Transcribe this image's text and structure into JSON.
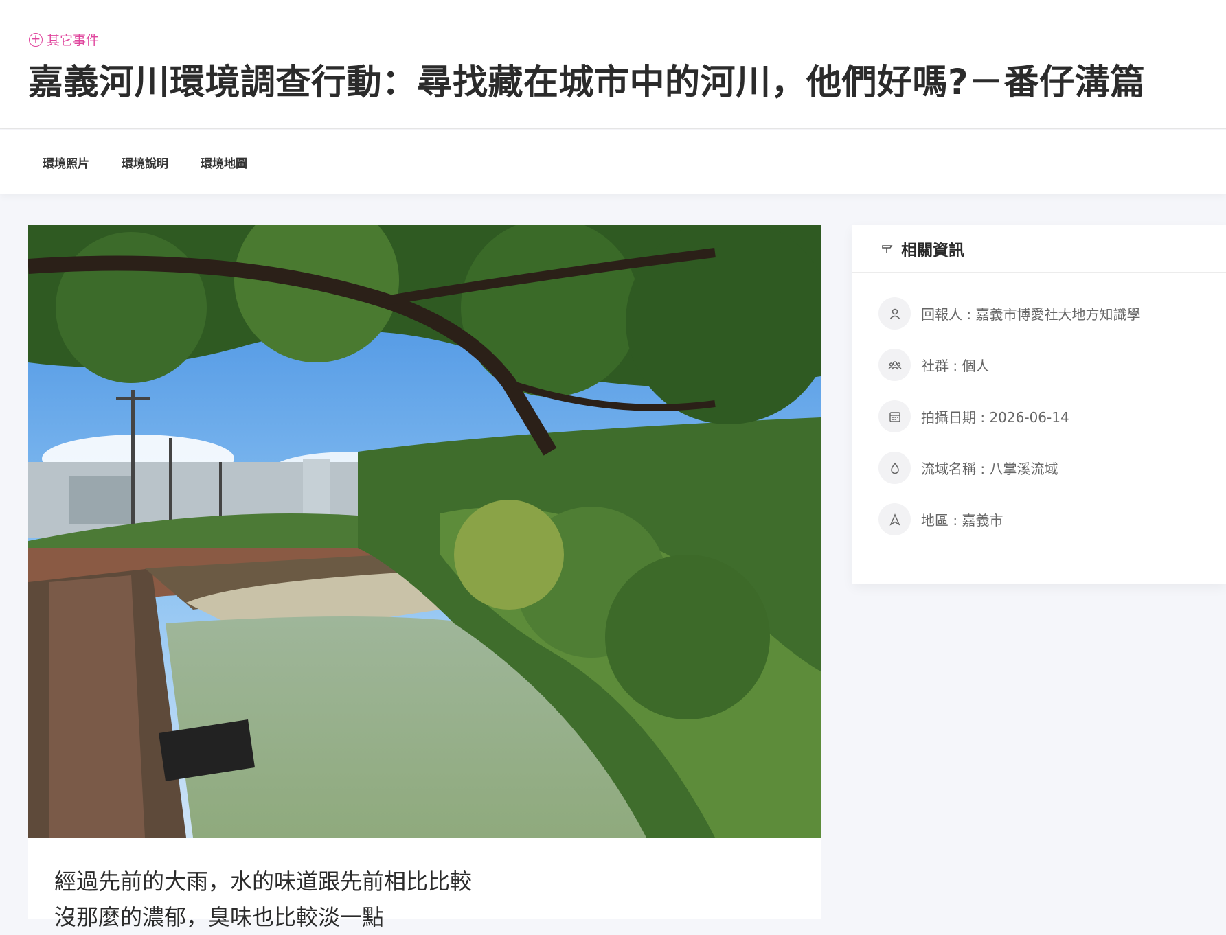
{
  "header": {
    "event_link_label": "其它事件",
    "title": "嘉義河川環境調查行動：尋找藏在城市中的河川，他們好嗎?－番仔溝篇"
  },
  "tabs": [
    {
      "label": "環境照片"
    },
    {
      "label": "環境說明"
    },
    {
      "label": "環境地圖"
    }
  ],
  "main": {
    "description": "經過先前的大雨，水的味道跟先前相比比較沒那麼的濃郁，臭味也比較淡一點"
  },
  "sidebar": {
    "title": "相關資訊",
    "items": [
      {
        "icon": "user-icon",
        "text": "回報人 : 嘉義市博愛社大地方知識學"
      },
      {
        "icon": "group-icon",
        "text": "社群 : 個人"
      },
      {
        "icon": "calendar-icon",
        "text": "拍攝日期 : 2026-06-14"
      },
      {
        "icon": "water-drop-icon",
        "text": "流域名稱 : 八掌溪流域"
      },
      {
        "icon": "location-icon",
        "text": "地區 : 嘉義市"
      }
    ]
  },
  "colors": {
    "accent": "#e0479e",
    "page_bg": "#f5f6fa",
    "card_bg": "#ffffff",
    "text": "#2b2b2b",
    "muted": "#666666"
  }
}
